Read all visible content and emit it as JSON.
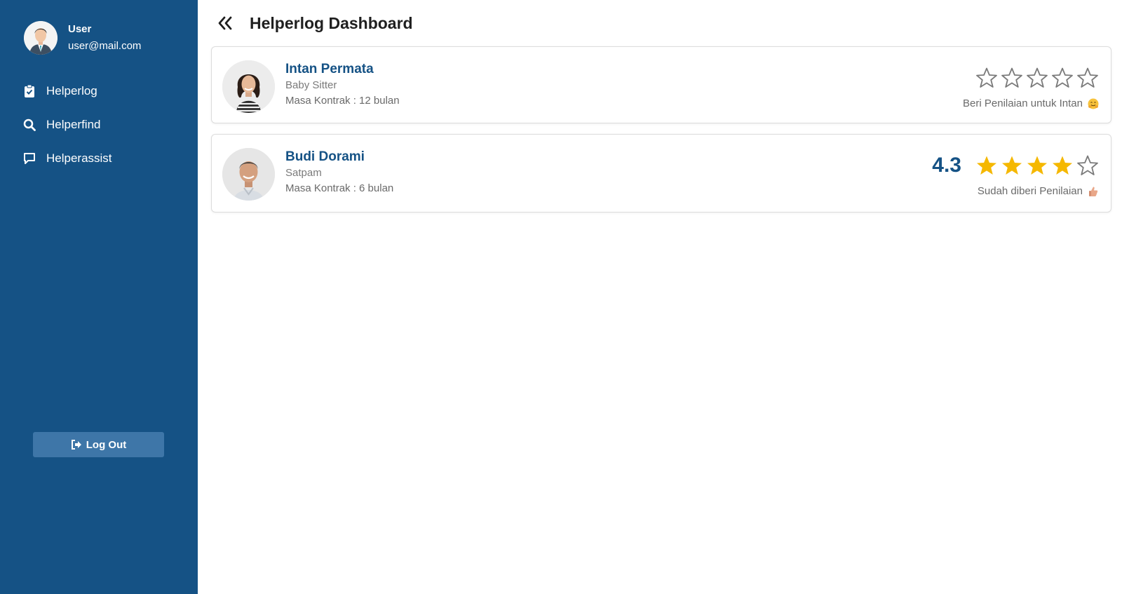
{
  "user": {
    "name": "User",
    "email": "user@mail.com"
  },
  "nav": [
    {
      "label": "Helperlog",
      "icon": "clipboard-check-icon"
    },
    {
      "label": "Helperfind",
      "icon": "search-icon"
    },
    {
      "label": "Helperassist",
      "icon": "chat-bubble-icon"
    }
  ],
  "logout_label": "Log Out",
  "page_title": "Helperlog Dashboard",
  "helpers": [
    {
      "name": "Intan Permata",
      "role": "Baby Sitter",
      "contract": "Masa Kontrak : 12 bulan",
      "rating_note": "Beri Penilaian untuk Intan",
      "rated": false,
      "stars_filled": 0,
      "stars_total": 5,
      "note_emoji": "hugging-face-emoji"
    },
    {
      "name": "Budi Dorami",
      "role": "Satpam",
      "contract": "Masa Kontrak : 6 bulan",
      "score": "4.3",
      "rating_note": "Sudah diberi Penilaian",
      "rated": true,
      "stars_filled": 4,
      "stars_total": 5,
      "note_emoji": "thumbs-up-emoji"
    }
  ],
  "colors": {
    "sidebar": "#155285",
    "accent": "#155285",
    "star_filled": "#f5b800",
    "star_empty": "#7a7a7a",
    "logout_bg": "#3e76a8"
  }
}
